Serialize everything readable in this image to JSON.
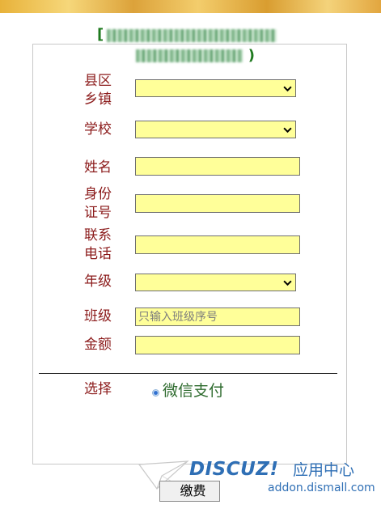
{
  "header": {
    "title_line1": "[",
    "title_line2": ")"
  },
  "form": {
    "fields": [
      {
        "label": "县区\n乡镇",
        "type": "select",
        "value": ""
      },
      {
        "label": "学校",
        "type": "select",
        "value": ""
      },
      {
        "label": "姓名",
        "type": "text",
        "value": "",
        "placeholder": ""
      },
      {
        "label": "身份\n证号",
        "type": "text",
        "value": "",
        "placeholder": ""
      },
      {
        "label": "联系\n电话",
        "type": "text",
        "value": "",
        "placeholder": ""
      },
      {
        "label": "年级",
        "type": "select",
        "value": ""
      },
      {
        "label": "班级",
        "type": "text",
        "value": "",
        "placeholder": "只输入班级序号"
      },
      {
        "label": "金额",
        "type": "text",
        "value": "",
        "placeholder": ""
      }
    ],
    "payment": {
      "label": "选择",
      "option": "微信支付",
      "selected": true
    },
    "submit_label": "缴费"
  },
  "watermark": {
    "brand": "DISCUZ!",
    "brand_cn": "应用中心",
    "url": "addon.dismall.com"
  },
  "colors": {
    "label": "#8b1a1a",
    "field_bg": "#ffff99",
    "title": "#1f7a1f",
    "option_text": "#2e6b2e",
    "watermark": "#2f6fb5"
  },
  "icons": [
    "chevron-down-icon",
    "radio-selected-icon",
    "paper-plane-icon"
  ]
}
